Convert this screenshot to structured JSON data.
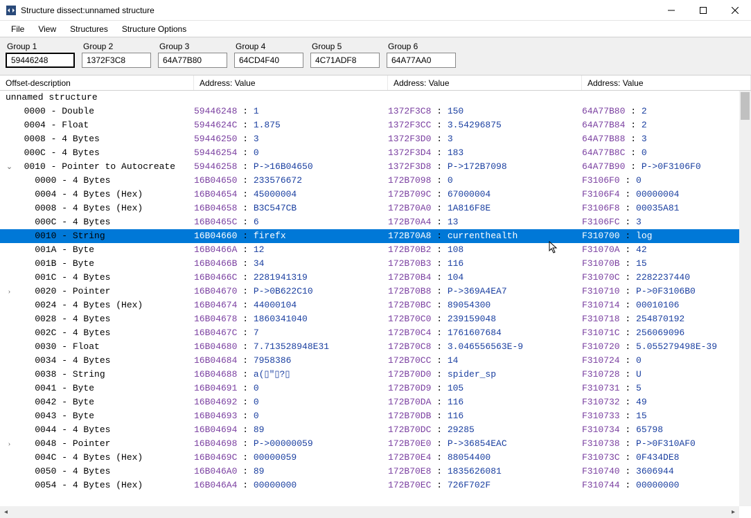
{
  "window": {
    "title": "Structure dissect:unnamed structure"
  },
  "menu": {
    "file": "File",
    "view": "View",
    "structures": "Structures",
    "options": "Structure Options"
  },
  "groups": [
    {
      "label": "Group 1",
      "value": "59446248",
      "active": true
    },
    {
      "label": "Group 2",
      "value": "1372F3C8",
      "active": false
    },
    {
      "label": "Group 3",
      "value": "64A77B80",
      "active": false
    },
    {
      "label": "Group 4",
      "value": "64CD4F40",
      "active": false
    },
    {
      "label": "Group 5",
      "value": "4C71ADF8",
      "active": false
    },
    {
      "label": "Group 6",
      "value": "64A77AA0",
      "active": false
    }
  ],
  "headers": {
    "offset": "Offset-description",
    "av": "Address: Value"
  },
  "root_label": "unnamed structure",
  "rows": [
    {
      "indent": 1,
      "exp": "",
      "offset": "0000 - Double",
      "a1": "59446248",
      "v1": "1",
      "a2": "1372F3C8",
      "v2": "150",
      "a3": "64A77B80",
      "v3": "2"
    },
    {
      "indent": 1,
      "exp": "",
      "offset": "0004 - Float",
      "a1": "5944624C",
      "v1": "1.875",
      "a2": "1372F3CC",
      "v2": "3.54296875",
      "a3": "64A77B84",
      "v3": "2"
    },
    {
      "indent": 1,
      "exp": "",
      "offset": "0008 - 4 Bytes",
      "a1": "59446250",
      "v1": "3",
      "a2": "1372F3D0",
      "v2": "3",
      "a3": "64A77B88",
      "v3": "3"
    },
    {
      "indent": 1,
      "exp": "",
      "offset": "000C - 4 Bytes",
      "a1": "59446254",
      "v1": "0",
      "a2": "1372F3D4",
      "v2": "183",
      "a3": "64A77B8C",
      "v3": "0"
    },
    {
      "indent": 1,
      "exp": "v",
      "offset": "0010 - Pointer to Autocreate",
      "a1": "59446258",
      "v1": "P->16B04650",
      "a2": "1372F3D8",
      "v2": "P->172B7098",
      "a3": "64A77B90",
      "v3": "P->0F3106F0"
    },
    {
      "indent": 2,
      "exp": "",
      "offset": "0000 - 4 Bytes",
      "a1": "16B04650",
      "v1": "233576672",
      "a2": "172B7098",
      "v2": "0",
      "a3": "F3106F0",
      "v3": "0"
    },
    {
      "indent": 2,
      "exp": "",
      "offset": "0004 - 4 Bytes (Hex)",
      "a1": "16B04654",
      "v1": "45000004",
      "a2": "172B709C",
      "v2": "67000004",
      "a3": "F3106F4",
      "v3": "00000004"
    },
    {
      "indent": 2,
      "exp": "",
      "offset": "0008 - 4 Bytes (Hex)",
      "a1": "16B04658",
      "v1": "B3C547CB",
      "a2": "172B70A0",
      "v2": "1A816F8E",
      "a3": "F3106F8",
      "v3": "00035A81"
    },
    {
      "indent": 2,
      "exp": "",
      "offset": "000C - 4 Bytes",
      "a1": "16B0465C",
      "v1": "6",
      "a2": "172B70A4",
      "v2": "13",
      "a3": "F3106FC",
      "v3": "3"
    },
    {
      "indent": 2,
      "exp": "",
      "offset": "0010 - String",
      "a1": "16B04660",
      "v1": "firefx",
      "a2": "172B70A8",
      "v2": "currenthealth",
      "a3": "F310700",
      "v3": "log",
      "selected": true
    },
    {
      "indent": 2,
      "exp": "",
      "offset": "001A - Byte",
      "a1": "16B0466A",
      "v1": "12",
      "a2": "172B70B2",
      "v2": "108",
      "a3": "F31070A",
      "v3": "42"
    },
    {
      "indent": 2,
      "exp": "",
      "offset": "001B - Byte",
      "a1": "16B0466B",
      "v1": "34",
      "a2": "172B70B3",
      "v2": "116",
      "a3": "F31070B",
      "v3": "15"
    },
    {
      "indent": 2,
      "exp": "",
      "offset": "001C - 4 Bytes",
      "a1": "16B0466C",
      "v1": "2281941319",
      "a2": "172B70B4",
      "v2": "104",
      "a3": "F31070C",
      "v3": "2282237440"
    },
    {
      "indent": 2,
      "exp": ">",
      "offset": "0020 - Pointer",
      "a1": "16B04670",
      "v1": "P->0B622C10",
      "a2": "172B70B8",
      "v2": "P->369A4EA7",
      "a3": "F310710",
      "v3": "P->0F3106B0"
    },
    {
      "indent": 2,
      "exp": "",
      "offset": "0024 - 4 Bytes (Hex)",
      "a1": "16B04674",
      "v1": "44000104",
      "a2": "172B70BC",
      "v2": "89054300",
      "a3": "F310714",
      "v3": "00010106"
    },
    {
      "indent": 2,
      "exp": "",
      "offset": "0028 - 4 Bytes",
      "a1": "16B04678",
      "v1": "1860341040",
      "a2": "172B70C0",
      "v2": "239159048",
      "a3": "F310718",
      "v3": "254870192"
    },
    {
      "indent": 2,
      "exp": "",
      "offset": "002C - 4 Bytes",
      "a1": "16B0467C",
      "v1": "7",
      "a2": "172B70C4",
      "v2": "1761607684",
      "a3": "F31071C",
      "v3": "256069096"
    },
    {
      "indent": 2,
      "exp": "",
      "offset": "0030 - Float",
      "a1": "16B04680",
      "v1": "7.713528948E31",
      "a2": "172B70C8",
      "v2": "3.046556563E-9",
      "a3": "F310720",
      "v3": "5.055279498E-39"
    },
    {
      "indent": 2,
      "exp": "",
      "offset": "0034 - 4 Bytes",
      "a1": "16B04684",
      "v1": "7958386",
      "a2": "172B70CC",
      "v2": "14",
      "a3": "F310724",
      "v3": "0"
    },
    {
      "indent": 2,
      "exp": "",
      "offset": "0038 - String",
      "a1": "16B04688",
      "v1": "a(▯\"▯?▯",
      "a2": "172B70D0",
      "v2": "spider_sp",
      "a3": "F310728",
      "v3": "U"
    },
    {
      "indent": 2,
      "exp": "",
      "offset": "0041 - Byte",
      "a1": "16B04691",
      "v1": "0",
      "a2": "172B70D9",
      "v2": "105",
      "a3": "F310731",
      "v3": "5"
    },
    {
      "indent": 2,
      "exp": "",
      "offset": "0042 - Byte",
      "a1": "16B04692",
      "v1": "0",
      "a2": "172B70DA",
      "v2": "116",
      "a3": "F310732",
      "v3": "49"
    },
    {
      "indent": 2,
      "exp": "",
      "offset": "0043 - Byte",
      "a1": "16B04693",
      "v1": "0",
      "a2": "172B70DB",
      "v2": "116",
      "a3": "F310733",
      "v3": "15"
    },
    {
      "indent": 2,
      "exp": "",
      "offset": "0044 - 4 Bytes",
      "a1": "16B04694",
      "v1": "89",
      "a2": "172B70DC",
      "v2": "29285",
      "a3": "F310734",
      "v3": "65798"
    },
    {
      "indent": 2,
      "exp": ">",
      "offset": "0048 - Pointer",
      "a1": "16B04698",
      "v1": "P->00000059",
      "a2": "172B70E0",
      "v2": "P->36854EAC",
      "a3": "F310738",
      "v3": "P->0F310AF0"
    },
    {
      "indent": 2,
      "exp": "",
      "offset": "004C - 4 Bytes (Hex)",
      "a1": "16B0469C",
      "v1": "00000059",
      "a2": "172B70E4",
      "v2": "88054400",
      "a3": "F31073C",
      "v3": "0F434DE8"
    },
    {
      "indent": 2,
      "exp": "",
      "offset": "0050 - 4 Bytes",
      "a1": "16B046A0",
      "v1": "89",
      "a2": "172B70E8",
      "v2": "1835626081",
      "a3": "F310740",
      "v3": "3606944"
    },
    {
      "indent": 2,
      "exp": "",
      "offset": "0054 - 4 Bytes (Hex)",
      "a1": "16B046A4",
      "v1": "00000000",
      "a2": "172B70EC",
      "v2": "726F702F",
      "a3": "F310744",
      "v3": "00000000"
    }
  ]
}
